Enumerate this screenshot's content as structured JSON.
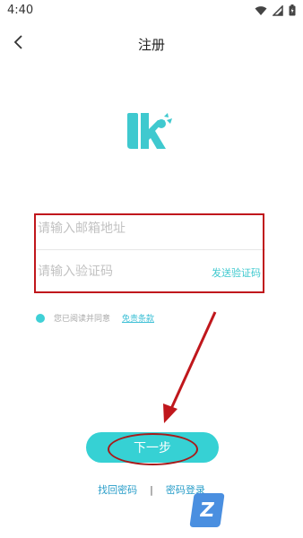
{
  "status_bar": {
    "time": "4:40",
    "icons": [
      "wifi-icon",
      "signal-icon",
      "battery-icon"
    ]
  },
  "header": {
    "title": "注册",
    "back_icon": "chevron-left-icon"
  },
  "logo": {
    "icon": "lk-logo-icon",
    "color": "#3fc9cf"
  },
  "form": {
    "email": {
      "placeholder": "请输入邮箱地址",
      "value": ""
    },
    "code": {
      "placeholder": "请输入验证码",
      "value": ""
    },
    "send_code_label": "发送验证码"
  },
  "agreement": {
    "text": "您已阅读并同意",
    "link": "免责条款"
  },
  "actions": {
    "next_label": "下一步",
    "links": [
      "找回密码",
      "密码登录"
    ],
    "separator": "|"
  },
  "watermark": {
    "char": "Z"
  },
  "colors": {
    "accent": "#36d1d4",
    "annotation": "#c0171c"
  }
}
